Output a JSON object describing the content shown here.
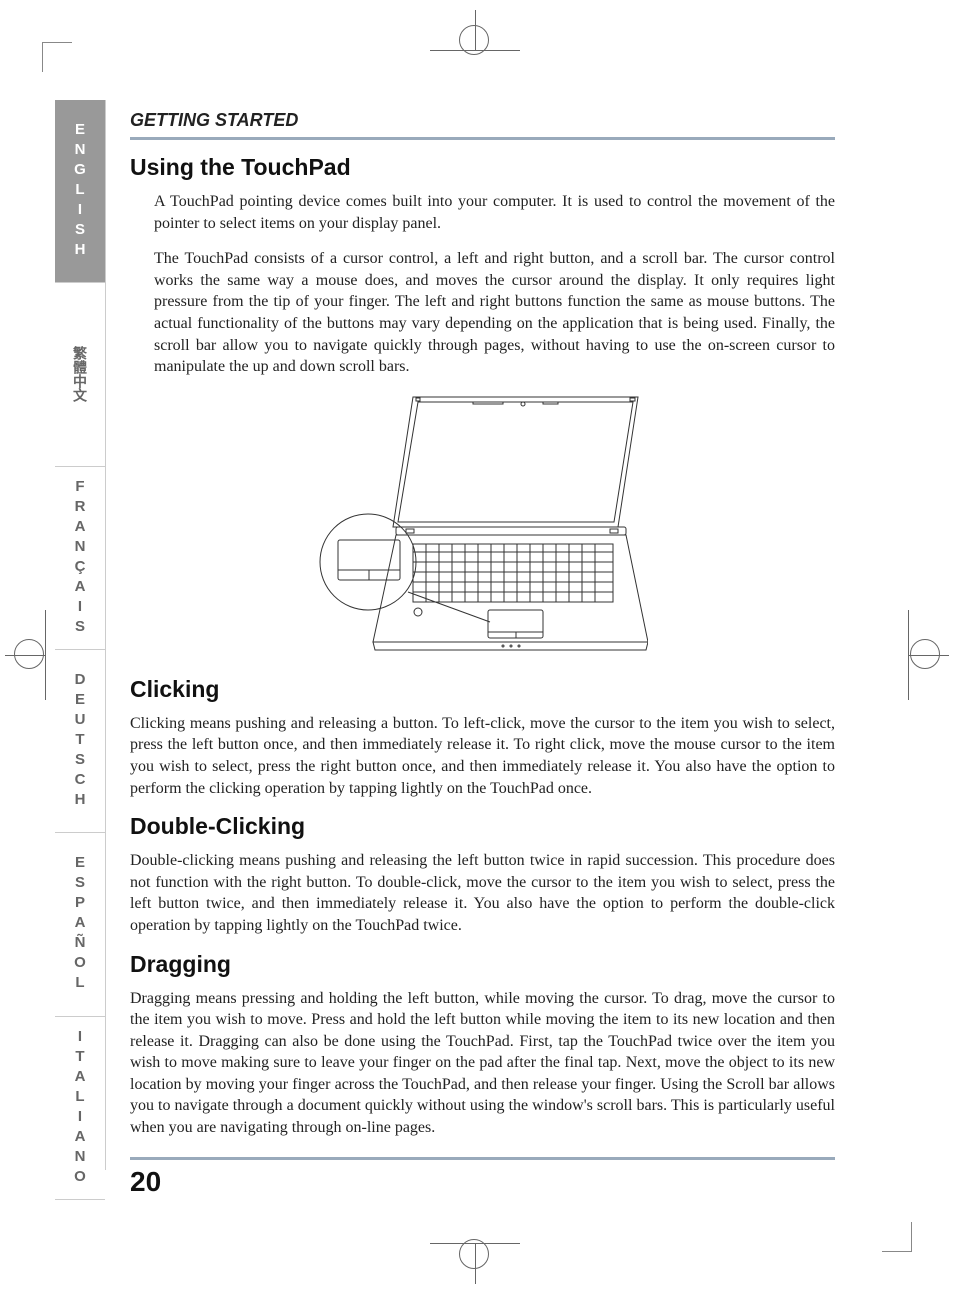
{
  "chapter_title": "GETTING STARTED",
  "page_number": "20",
  "sidebar": {
    "languages": [
      "ENGLISH",
      "繁體中文",
      "FRANÇAIS",
      "DEUTSCH",
      "ESPAÑOL",
      "ITALIANO"
    ],
    "active_index": 0
  },
  "sections": [
    {
      "heading": "Using the TouchPad",
      "paragraphs": [
        "A TouchPad pointing device comes built into your computer. It is used to control the movement of the pointer to select items on your display panel.",
        "The TouchPad consists of a cursor control, a left and right button, and a scroll bar. The cursor control works the same way a mouse does, and moves the cursor around the display. It only requires light pressure from the tip of your finger. The left and right buttons function the same as mouse buttons. The actual functionality of the buttons may vary depending on the application that is being used. Finally, the scroll bar allow you to navigate quickly through pages, without having to use the on-screen cursor to manipulate the up and down scroll bars."
      ]
    },
    {
      "heading": "Clicking",
      "paragraphs": [
        "Clicking means pushing and releasing a button. To left-click, move the cursor to the item you wish to select, press the left button once, and then immediately release it. To right click, move the mouse cursor to the item you wish to select, press the right button once, and then immediately release it. You also have the option to perform the clicking operation by tapping lightly on the TouchPad once."
      ]
    },
    {
      "heading": "Double-Clicking",
      "paragraphs": [
        "Double-clicking means pushing and releasing the left button twice in rapid succession. This procedure does not function with the right button. To double-click, move the cursor to the item you wish to select, press the left button twice, and then immediately release it. You also have the option to perform the double-click operation by tapping lightly on the TouchPad twice."
      ]
    },
    {
      "heading": "Dragging",
      "paragraphs": [
        "Dragging means pressing and holding the left button, while moving the cursor. To drag, move the cursor to the item you wish to move. Press and hold the left button while moving the item to its new location and then release it. Dragging can also be done using the TouchPad. First, tap the TouchPad twice over the item you wish to move making sure to leave your finger on the pad after the final tap. Next, move the object to its new location by moving your finger across the TouchPad, and then release your finger. Using the Scroll bar allows you to navigate through a document quickly without using the window's scroll bars. This is particularly useful when you are navigating through on-line pages."
      ]
    }
  ],
  "figure": {
    "alt": "Laptop illustration with TouchPad callout"
  }
}
